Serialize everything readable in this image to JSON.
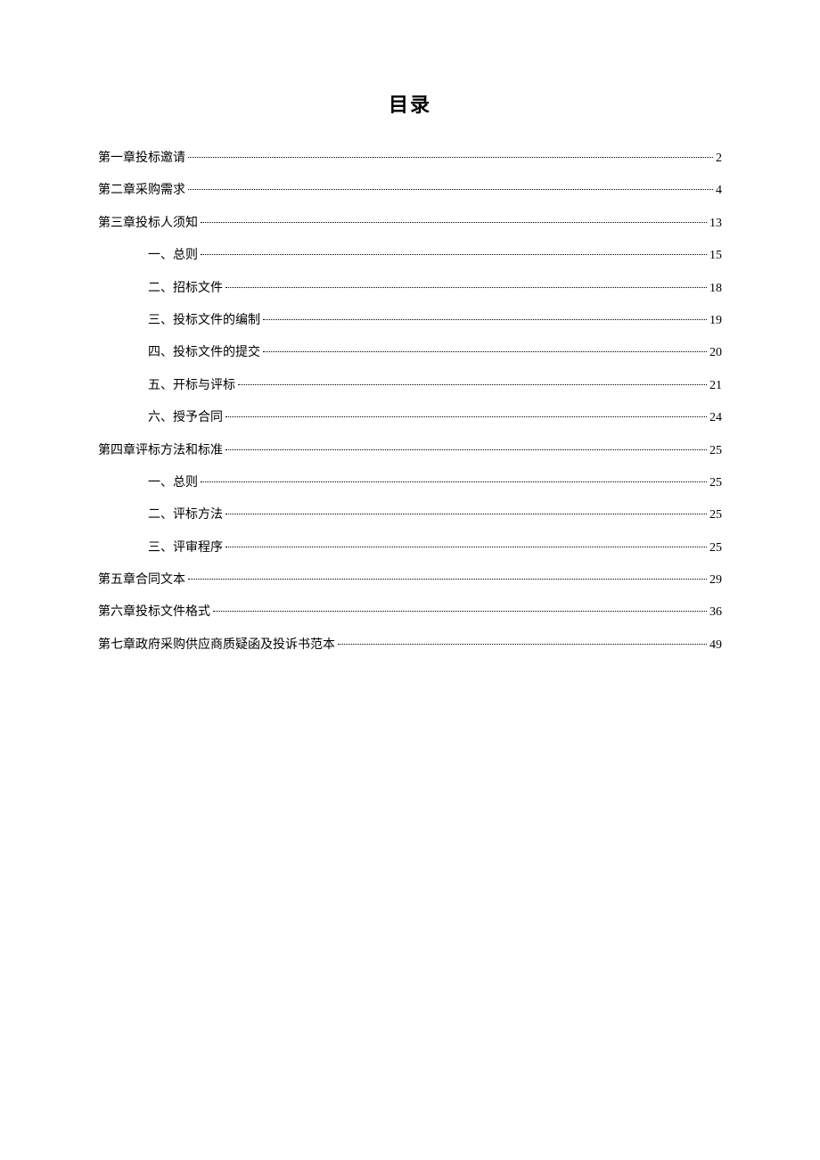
{
  "title": "目录",
  "entries": [
    {
      "label": "第一章投标邀请",
      "page": "2",
      "level": 0
    },
    {
      "label": "第二章采购需求",
      "page": "4",
      "level": 0
    },
    {
      "label": "第三章投标人须知",
      "page": "13",
      "level": 0
    },
    {
      "label": "一、总则",
      "page": "15",
      "level": 1
    },
    {
      "label": "二、招标文件",
      "page": "18",
      "level": 1
    },
    {
      "label": "三、投标文件的编制",
      "page": "19",
      "level": 1
    },
    {
      "label": "四、投标文件的提交",
      "page": "20",
      "level": 1
    },
    {
      "label": "五、开标与评标",
      "page": "21",
      "level": 1
    },
    {
      "label": "六、授予合同",
      "page": "24",
      "level": 1
    },
    {
      "label": "第四章评标方法和标准",
      "page": "25",
      "level": 0
    },
    {
      "label": "一、总则",
      "page": "25",
      "level": 1
    },
    {
      "label": "二、评标方法",
      "page": "25",
      "level": 1
    },
    {
      "label": "三、评审程序",
      "page": "25",
      "level": 1
    },
    {
      "label": "第五章合同文本",
      "page": "29",
      "level": 0
    },
    {
      "label": "第六章投标文件格式",
      "page": "36",
      "level": 0
    },
    {
      "label": "第七章政府采购供应商质疑函及投诉书范本",
      "page": "49",
      "level": 0
    }
  ]
}
